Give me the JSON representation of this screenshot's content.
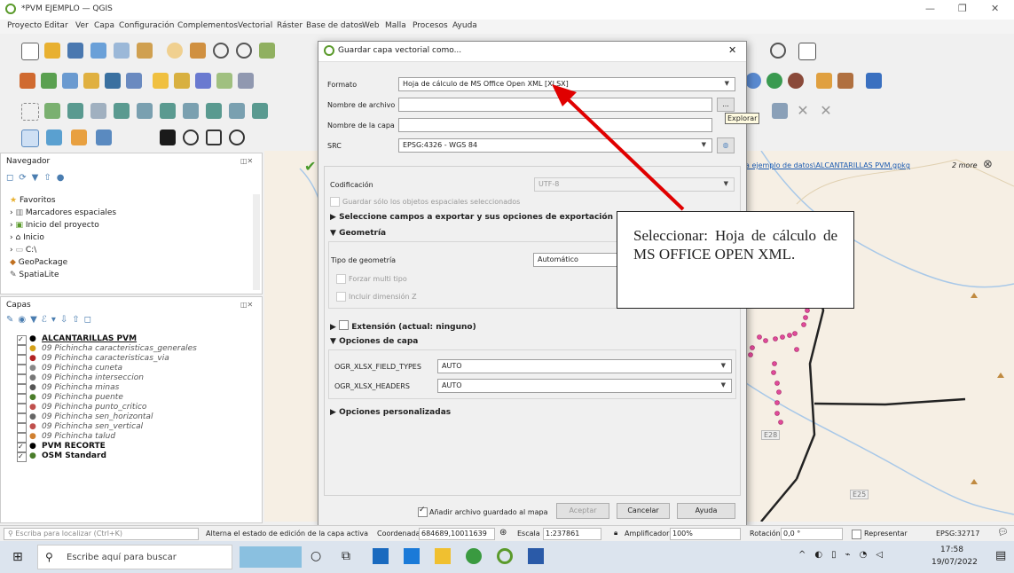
{
  "window": {
    "title": "*PVM EJEMPLO — QGIS"
  },
  "menu": [
    "Proyecto",
    "Editar",
    "Ver",
    "Capa",
    "Configuración",
    "Complementos",
    "Vectorial",
    "Ráster",
    "Base de datos",
    "Web",
    "Malla",
    "Procesos",
    "Ayuda"
  ],
  "browser": {
    "title": "Navegador",
    "items": [
      "Favoritos",
      "Marcadores espaciales",
      "Inicio del proyecto",
      "Inicio",
      "C:\\",
      "GeoPackage",
      "SpatiaLite"
    ]
  },
  "layers": {
    "title": "Capas",
    "items": [
      {
        "name": "ALCANTARILLAS PVM",
        "checked": true,
        "color": "#000000"
      },
      {
        "name": "09 Pichincha caracteristicas_generales",
        "checked": false,
        "color": "#d4a017"
      },
      {
        "name": "09 Pichincha caracteristicas_via",
        "checked": false,
        "color": "#b22222"
      },
      {
        "name": "09 Pichincha cuneta",
        "checked": false,
        "color": "#888888"
      },
      {
        "name": "09 Pichincha interseccion",
        "checked": false,
        "color": "#777777"
      },
      {
        "name": "09 Pichincha minas",
        "checked": false,
        "color": "#555555"
      },
      {
        "name": "09 Pichincha puente",
        "checked": false,
        "color": "#4a7d2a"
      },
      {
        "name": "09 Pichincha punto_critico",
        "checked": false,
        "color": "#c0504d"
      },
      {
        "name": "09 Pichincha sen_horizontal",
        "checked": false,
        "color": "#666666"
      },
      {
        "name": "09 Pichincha sen_vertical",
        "checked": false,
        "color": "#c0504d"
      },
      {
        "name": "09 Pichincha talud",
        "checked": false,
        "color": "#d08030"
      },
      {
        "name": "PVM RECORTE",
        "checked": true,
        "color": "#000000"
      },
      {
        "name": "OSM Standard",
        "checked": true,
        "color": "#4a7d2a"
      }
    ]
  },
  "map": {
    "message_link": "a ejemplo de datos\\ALCANTARILLAS PVM.gpkg",
    "more": "2 more",
    "road_labels": [
      "E28",
      "E25"
    ]
  },
  "dialog": {
    "title": "Guardar capa vectorial como...",
    "formato_label": "Formato",
    "formato_value": "Hoja de cálculo de MS Office Open XML [XLSX]",
    "archivo_label": "Nombre de archivo",
    "archivo_btn": "...",
    "explorar_tip": "Explorar",
    "capa_label": "Nombre de la capa",
    "src_label": "SRC",
    "src_value": "EPSG:4326 - WGS 84",
    "codificacion_label": "Codificación",
    "codificacion_value": "UTF-8",
    "solo_seleccionados": "Guardar sólo los objetos espaciales seleccionados",
    "campos_section": "Seleccione campos a exportar y sus opciones de exportación",
    "geometria_section": "Geometría",
    "tipo_geom_label": "Tipo de geometría",
    "tipo_geom_value": "Automático",
    "forzar_multi": "Forzar multi tipo",
    "incluir_z": "Incluir dimensión Z",
    "extension_section": "Extensión (actual: ninguno)",
    "opciones_capa_section": "Opciones de capa",
    "field_types_label": "OGR_XLSX_FIELD_TYPES",
    "field_types_value": "AUTO",
    "headers_label": "OGR_XLSX_HEADERS",
    "headers_value": "AUTO",
    "personalizadas_section": "Opciones personalizadas",
    "anadir_label": "Añadir archivo guardado al mapa",
    "aceptar": "Aceptar",
    "cancelar": "Cancelar",
    "ayuda": "Ayuda"
  },
  "callout": {
    "text": "Seleccionar: Hoja de cálculo de MS OFFICE OPEN XML."
  },
  "status": {
    "search_placeholder": "Escriba para localizar (Ctrl+K)",
    "edit_hint": "Alterna el estado de edición de la capa activa",
    "coord_label": "Coordenada",
    "coord_value": "684689,10011639",
    "scale_label": "Escala",
    "scale_value": "1:237861",
    "amp_label": "Amplificador",
    "amp_value": "100%",
    "rot_label": "Rotación",
    "rot_value": "0,0 °",
    "render_label": "Representar",
    "epsg": "EPSG:32717"
  },
  "taskbar": {
    "search_placeholder": "Escribe aquí para buscar",
    "time": "17:58",
    "date": "19/07/2022"
  },
  "colors": {
    "accent_red": "#e00000",
    "qgis_green": "#5a9a2b"
  }
}
